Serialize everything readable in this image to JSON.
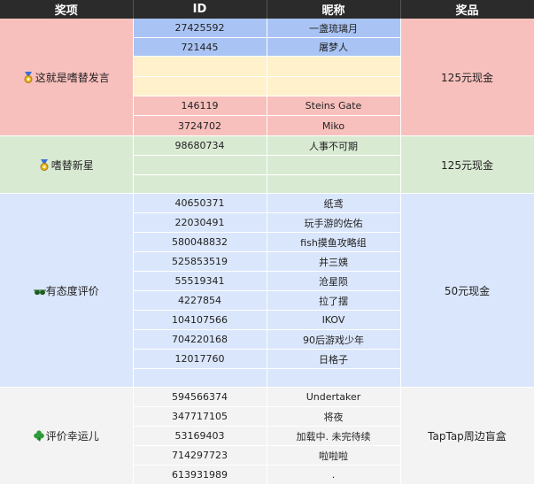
{
  "header": {
    "award": "奖项",
    "id": "ID",
    "nickname": "昵称",
    "prize": "奖品"
  },
  "groups": [
    {
      "award": "这就是嗜替发言",
      "icon": "medal-icon",
      "prize": "125元现金",
      "rows": [
        {
          "id": "27425592",
          "name": "一盏琉璃月"
        },
        {
          "id": "721445",
          "name": "屠梦人"
        },
        {
          "id": "",
          "name": ""
        },
        {
          "id": "",
          "name": ""
        },
        {
          "id": "146119",
          "name": "Steins Gate"
        },
        {
          "id": "3724702",
          "name": "Miko"
        }
      ]
    },
    {
      "award": "嗜替新星",
      "icon": "medal-icon",
      "prize": "125元现金",
      "rows": [
        {
          "id": "98680734",
          "name": "人事不可期"
        },
        {
          "id": "",
          "name": ""
        },
        {
          "id": "",
          "name": ""
        }
      ]
    },
    {
      "award": "有态度评价",
      "icon": "sunglasses-icon",
      "prize": "50元现金",
      "rows": [
        {
          "id": "40650371",
          "name": "纸鸢"
        },
        {
          "id": "22030491",
          "name": "玩手游的佐佑"
        },
        {
          "id": "580048832",
          "name": "fish摸鱼攻略组"
        },
        {
          "id": "525853519",
          "name": "井三姨"
        },
        {
          "id": "55519341",
          "name": "沧星陨"
        },
        {
          "id": "4227854",
          "name": "拉了摆"
        },
        {
          "id": "104107566",
          "name": "IKOV"
        },
        {
          "id": "704220168",
          "name": "90后游戏少年"
        },
        {
          "id": "12017760",
          "name": "日格子"
        },
        {
          "id": "",
          "name": ""
        }
      ]
    },
    {
      "award": "评价幸运儿",
      "icon": "clover-icon",
      "prize": "TapTap周边盲盒",
      "rows": [
        {
          "id": "594566374",
          "name": "Undertaker"
        },
        {
          "id": "347717105",
          "name": "将夜"
        },
        {
          "id": "53169403",
          "name": "加载中. 未完待续"
        },
        {
          "id": "714297723",
          "name": "啦啦啦"
        },
        {
          "id": "613931989",
          "name": "."
        }
      ]
    }
  ]
}
